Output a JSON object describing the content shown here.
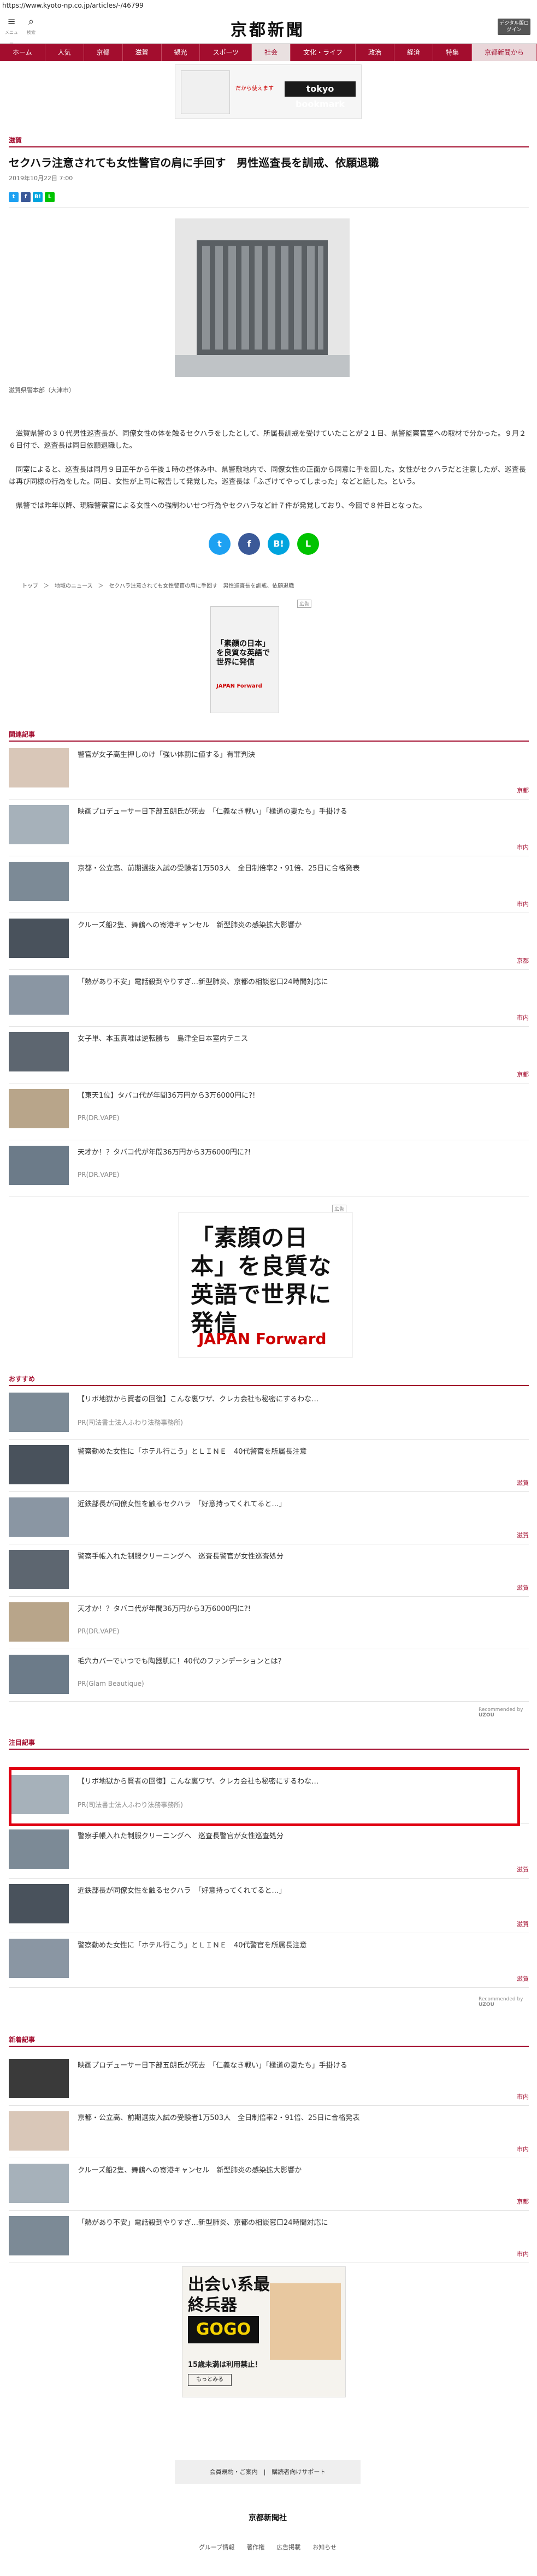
{
  "url": "https://www.kyoto-np.co.jp/articles/-/46799",
  "header": {
    "logo": "京都新聞",
    "menu_label": "メニュー",
    "search_label": "検索",
    "digital_label": "デジタル版ログイン"
  },
  "nav": [
    "ホーム",
    "人気",
    "京都",
    "滋賀",
    "観光",
    "スポーツ",
    "社会",
    "文化・ライフ",
    "政治",
    "経済",
    "特集",
    "京都新聞から"
  ],
  "top_ad": {
    "tag": "だから使えます",
    "brand": "tokyo bookmark"
  },
  "article": {
    "category": "滋賀",
    "title": "セクハラ注意されても女性警官の肩に手回す　男性巡査長を訓戒、依願退職",
    "date": "2019年10月22日 7:00",
    "caption": "滋賀県警本部（大津市）",
    "paragraphs": [
      "　滋賀県警の３０代男性巡査長が、同僚女性の体を触るセクハラをしたとして、所属長訓戒を受けていたことが２１日、県警監察官室への取材で分かった。９月２６日付で、巡査長は同日依願退職した。",
      "　同室によると、巡査長は同月９日正午から午後１時の昼休み中、県警敷地内で、同僚女性の正面から同意に手を回した。女性がセクハラだと注意したが、巡査長は再び同様の行為をした。同日、女性が上司に報告して発覚した。巡査長は「ふざけてやってしまった」などと話した。という。",
      "　県警では昨年以降、現職警察官による女性への強制わいせつ行為やセクハラなど計７件が発覚しており、今回で８件目となった。"
    ],
    "breadcrumb": "トップ　＞　地域のニュース　＞　セクハラ注意されても女性警官の肩に手回す　男性巡査長を訓戒、依願退職"
  },
  "share": {
    "twitter": "t",
    "facebook": "f",
    "hatena": "B!",
    "line": "L"
  },
  "ad_label": "広告",
  "small_ad": {
    "text": "「素顔の日本」を良質な英語で世界に発信",
    "brand": "JAPAN Forward"
  },
  "related": {
    "title": "関連記事",
    "items": [
      {
        "title": "警官が女子高生押しのけ「強い体罰に値する」有罪判決",
        "cat": "京都"
      },
      {
        "title": "映画プロデューサー日下部五朗氏が死去　「仁義なき戦い」「極道の妻たち」手掛ける",
        "cat": "市内"
      },
      {
        "title": "京都・公立高、前期選抜入試の受験者1万503人　全日制倍率2・91倍、25日に合格発表",
        "cat": "市内"
      },
      {
        "title": "クルーズ船2隻、舞鶴への寄港キャンセル　新型肺炎の感染拡大影響か",
        "cat": "京都"
      },
      {
        "title": "「熱があり不安」電話殺到やりすぎ…新型肺炎、京都の相談窓口24時間対応に",
        "cat": "市内"
      },
      {
        "title": "女子単、本玉真唯は逆転勝ち　島津全日本室内テニス",
        "cat": "京都"
      },
      {
        "title": "【東天1位】タバコ代が年間36万円から3万6000円に?!",
        "sub": "PR(DR.VAPE)",
        "cat": ""
      },
      {
        "title": "天才か！？タバコ代が年間36万円から3万6000円に?!",
        "sub": "PR(DR.VAPE)",
        "cat": ""
      }
    ]
  },
  "big_ad": {
    "line": "「素顔の日本」を良質な英語で世界に発信",
    "brand": "JAPAN Forward"
  },
  "recommend": {
    "title": "おすすめ",
    "items": [
      {
        "title": "【リボ地獄から賢者の回復】こんな裏ワザ、クレカ会社も秘密にするわな…",
        "sub": "PR(司法書士法人ふわり法務事務所)",
        "cat": ""
      },
      {
        "title": "警察勤めた女性に「ホテル行こう」とＬＩＮＥ　40代警官を所属長注意",
        "cat": "滋賀"
      },
      {
        "title": "近鉄部長が同僚女性を触るセクハラ　「好意持ってくれてると…」",
        "cat": "滋賀"
      },
      {
        "title": "警察手帳入れた制服クリーニングへ　巡査長警官が女性巡査処分",
        "cat": "滋賀"
      },
      {
        "title": "天才か！？タバコ代が年間36万円から3万6000円に?!",
        "sub": "PR(DR.VAPE)",
        "cat": ""
      },
      {
        "title": "毛穴カバーでいつでも陶器肌に！40代のファンデーションとは？",
        "sub": "PR(Glam Beautique)",
        "cat": ""
      }
    ],
    "credit": "Recommended by",
    "credit_brand": "UZOU"
  },
  "featured": {
    "title": "注目記事",
    "items": [
      {
        "title": "【リボ地獄から賢者の回復】こんな裏ワザ、クレカ会社も秘密にするわな…",
        "sub": "PR(司法書士法人ふわり法務事務所)",
        "cat": ""
      },
      {
        "title": "警察手帳入れた制服クリーニングへ　巡査長警官が女性巡査処分",
        "cat": "滋賀"
      },
      {
        "title": "近鉄部長が同僚女性を触るセクハラ　「好意持ってくれてると…」",
        "cat": "滋賀"
      },
      {
        "title": "警察勤めた女性に「ホテル行こう」とＬＩＮＥ　40代警官を所属長注意",
        "cat": "滋賀"
      }
    ],
    "credit": "Recommended by",
    "credit_brand": "UZOU"
  },
  "latest": {
    "title": "新着記事",
    "items": [
      {
        "title": "映画プロデューサー日下部五朗氏が死去　「仁義なき戦い」「極道の妻たち」手掛ける",
        "cat": "市内"
      },
      {
        "title": "京都・公立高、前期選抜入試の受験者1万503人　全日制倍率2・91倍、25日に合格発表",
        "cat": "市内"
      },
      {
        "title": "クルーズ船2隻、舞鶴への寄港キャンセル　新型肺炎の感染拡大影響か",
        "cat": "京都"
      },
      {
        "title": "「熱があり不安」電話殺到やりすぎ…新型肺炎、京都の相談窓口24時間対応に",
        "cat": "市内"
      }
    ]
  },
  "gogo_ad": {
    "line": "出会い系最終兵器",
    "brand": "GOGO",
    "note": "15歳未満は利用禁止！",
    "button": "もっとみる"
  },
  "footer": {
    "links": "会員規約・ご案内　|　購読者向けサポート",
    "logo": "京都新聞社",
    "bottom": "グループ情報　　著作権　　広告掲載　　お知らせ"
  }
}
